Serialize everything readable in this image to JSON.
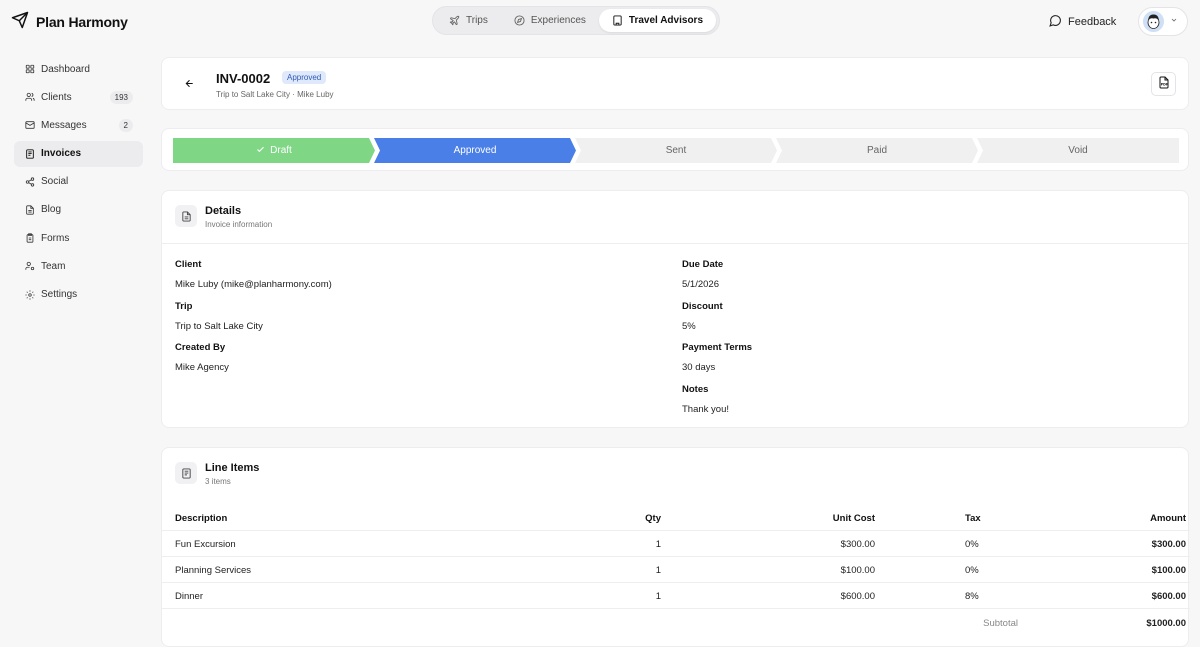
{
  "app": {
    "name": "Plan Harmony"
  },
  "topnav": {
    "items": [
      {
        "label": "Trips",
        "icon": "plane-icon"
      },
      {
        "label": "Experiences",
        "icon": "compass-icon"
      },
      {
        "label": "Travel Advisors",
        "icon": "building-icon",
        "active": true
      }
    ]
  },
  "feedback": {
    "label": "Feedback"
  },
  "sidebar": {
    "items": [
      {
        "label": "Dashboard",
        "icon": "grid-icon",
        "badge": ""
      },
      {
        "label": "Clients",
        "icon": "users-icon",
        "badge": "193"
      },
      {
        "label": "Messages",
        "icon": "mail-icon",
        "badge": "2"
      },
      {
        "label": "Invoices",
        "icon": "receipt-icon",
        "badge": "",
        "active": true
      },
      {
        "label": "Social",
        "icon": "share-icon",
        "badge": ""
      },
      {
        "label": "Blog",
        "icon": "document-icon",
        "badge": ""
      },
      {
        "label": "Forms",
        "icon": "clipboard-icon",
        "badge": ""
      },
      {
        "label": "Team",
        "icon": "user-cog-icon",
        "badge": ""
      },
      {
        "label": "Settings",
        "icon": "gear-icon",
        "badge": ""
      }
    ]
  },
  "invoice": {
    "number": "INV-0002",
    "status": "Approved",
    "subtitle": "Trip to Salt Lake City · Mike Luby"
  },
  "steps": [
    "Draft",
    "Approved",
    "Sent",
    "Paid",
    "Void"
  ],
  "details": {
    "title": "Details",
    "subtitle": "Invoice information",
    "client_label": "Client",
    "client_value": "Mike Luby (mike@planharmony.com)",
    "trip_label": "Trip",
    "trip_value": "Trip to Salt Lake City",
    "created_label": "Created By",
    "created_value": "Mike Agency",
    "due_label": "Due Date",
    "due_value": "5/1/2026",
    "discount_label": "Discount",
    "discount_value": "5%",
    "terms_label": "Payment Terms",
    "terms_value": "30 days",
    "notes_label": "Notes",
    "notes_value": "Thank you!"
  },
  "line_items": {
    "title": "Line Items",
    "subtitle": "3 items",
    "columns": [
      "Description",
      "Qty",
      "Unit Cost",
      "Tax",
      "Amount"
    ],
    "rows": [
      {
        "description": "Fun Excursion",
        "qty": "1",
        "unit_cost": "$300.00",
        "tax": "0%",
        "amount": "$300.00"
      },
      {
        "description": "Planning Services",
        "qty": "1",
        "unit_cost": "$100.00",
        "tax": "0%",
        "amount": "$100.00"
      },
      {
        "description": "Dinner",
        "qty": "1",
        "unit_cost": "$600.00",
        "tax": "8%",
        "amount": "$600.00"
      }
    ],
    "subtotal_label": "Subtotal",
    "subtotal_value": "$1000.00"
  },
  "colors": {
    "step_done": "#7fd786",
    "step_current": "#4a7fe8",
    "step_todo": "#f0f0f1",
    "badge_bg": "#dfe9fb",
    "badge_text": "#2f5bb3"
  }
}
